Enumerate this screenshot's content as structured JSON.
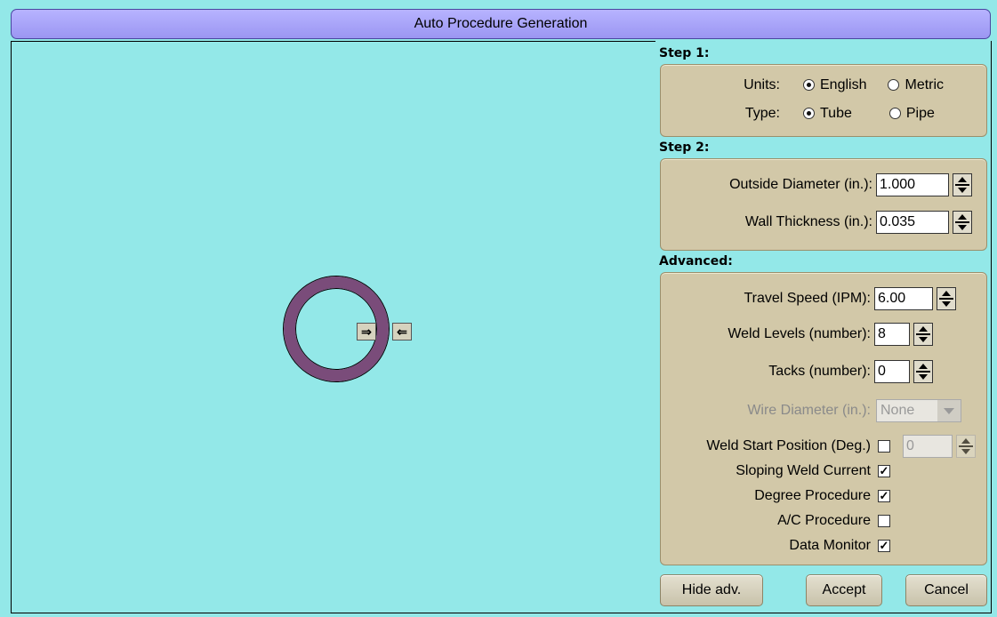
{
  "window": {
    "title": "Auto Procedure Generation"
  },
  "canvas": {
    "left_arrow": "⇒",
    "right_arrow": "⇐"
  },
  "step1": {
    "label": "Step 1:",
    "units_label": "Units:",
    "units_options": [
      "English",
      "Metric"
    ],
    "units_selected": "English",
    "type_label": "Type:",
    "type_options": [
      "Tube",
      "Pipe"
    ],
    "type_selected": "Tube"
  },
  "step2": {
    "label": "Step 2:",
    "outside_diameter_label": "Outside Diameter (in.):",
    "outside_diameter_value": "1.000",
    "wall_thickness_label": "Wall Thickness (in.):",
    "wall_thickness_value": "0.035"
  },
  "advanced": {
    "label": "Advanced:",
    "travel_speed_label": "Travel Speed (IPM):",
    "travel_speed_value": "6.00",
    "weld_levels_label": "Weld Levels (number):",
    "weld_levels_value": "8",
    "tacks_label": "Tacks (number):",
    "tacks_value": "0",
    "wire_diameter_label": "Wire Diameter (in.):",
    "wire_diameter_value": "None",
    "weld_start_label": "Weld Start Position (Deg.)",
    "weld_start_checked": false,
    "weld_start_value": "0",
    "sloping_label": "Sloping Weld Current",
    "sloping_checked": true,
    "degree_label": "Degree Procedure",
    "degree_checked": true,
    "ac_label": "A/C Procedure",
    "ac_checked": false,
    "data_monitor_label": "Data Monitor",
    "data_monitor_checked": true
  },
  "buttons": {
    "hide_adv": "Hide adv.",
    "accept": "Accept",
    "cancel": "Cancel"
  },
  "colors": {
    "background": "#93e8e8",
    "panel": "#d2c8a8",
    "title_bar": "#9b96f2",
    "pipe": "#7a4c7a"
  }
}
